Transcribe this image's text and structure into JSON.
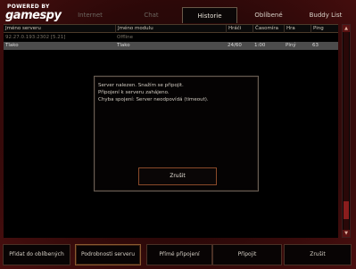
{
  "logo": {
    "powered": "POWERED BY",
    "brand": "gamespy"
  },
  "tabs": [
    {
      "label": "Internet"
    },
    {
      "label": "Chat"
    },
    {
      "label": "Historie"
    },
    {
      "label": "Oblíbené"
    },
    {
      "label": "Buddy List"
    }
  ],
  "columns": [
    {
      "label": "Jméno serveru"
    },
    {
      "label": "Jméno modulu"
    },
    {
      "label": "Hráči"
    },
    {
      "label": "Časomíra"
    },
    {
      "label": "Hra"
    },
    {
      "label": "Ping"
    }
  ],
  "rows": [
    {
      "name": "92.27.0.193:2302 [5.21]",
      "mod": "Offline",
      "players": "",
      "time": "",
      "game": "",
      "ping": ""
    },
    {
      "name": "Tlako",
      "mod": "Tlako",
      "players": "24/60",
      "time": "1:00",
      "game": "Plný",
      "ping": "63"
    }
  ],
  "dialog": {
    "message": "Server nalezen. Snažím se připojit.\nPřipojení k serveru zahájeno.\nChyba spojení: Server neodpovídá (timeout).",
    "button": "Zrušit"
  },
  "bottom": {
    "add_fav": "Přidat do oblíbených",
    "server_details": "Podrobnosti serveru",
    "direct_connect": "Přímé připojení",
    "connect": "Připojit",
    "cancel": "Zrušit"
  }
}
